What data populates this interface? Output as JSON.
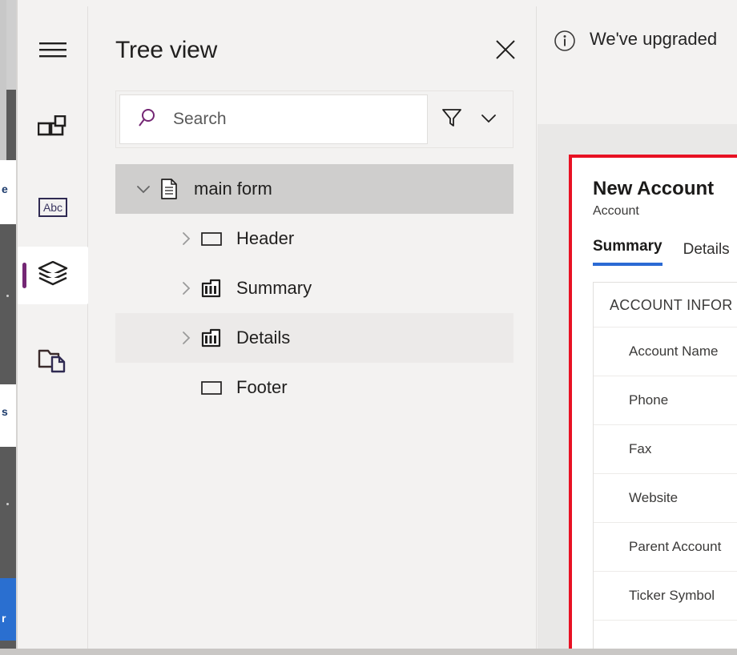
{
  "edge_panel": {
    "fragment_texts": [
      "e",
      "s"
    ],
    "button_fragment": "r"
  },
  "rail": {
    "items": [
      {
        "name": "hamburger-menu",
        "icon": "hamburger-icon",
        "active": false
      },
      {
        "name": "components",
        "icon": "components-grid-icon",
        "active": false
      },
      {
        "name": "text-label",
        "icon": "abc-text-icon",
        "active": false,
        "glyph": "Abc"
      },
      {
        "name": "tree-view",
        "icon": "layers-icon",
        "active": true
      },
      {
        "name": "related-files",
        "icon": "folder-file-icon",
        "active": false
      }
    ],
    "accent_color": "#742774"
  },
  "tree_panel": {
    "title": "Tree view",
    "close_label": "close-icon",
    "search": {
      "placeholder": "Search",
      "value": "",
      "icon": "search-icon",
      "filter_icon": "filter-funnel-icon",
      "chevron_icon": "chevron-down-icon"
    },
    "rows": [
      {
        "label": "main form",
        "icon": "document-icon",
        "twisty": "chevron-down-icon",
        "indent": 0,
        "state": "selected"
      },
      {
        "label": "Header",
        "icon": "rectangle-icon",
        "twisty": "chevron-right-icon",
        "indent": 1,
        "state": "normal"
      },
      {
        "label": "Summary",
        "icon": "columns-icon",
        "twisty": "chevron-right-icon",
        "indent": 1,
        "state": "normal"
      },
      {
        "label": "Details",
        "icon": "columns-icon",
        "twisty": "chevron-right-icon",
        "indent": 1,
        "state": "hover"
      },
      {
        "label": "Footer",
        "icon": "rectangle-icon",
        "twisty": "none",
        "indent": 1,
        "state": "normal"
      }
    ]
  },
  "main": {
    "banner": {
      "icon": "info-circle-icon",
      "text": "We've upgraded"
    },
    "form_preview": {
      "highlight_color": "#e81123",
      "title": "New Account",
      "subtitle": "Account",
      "tabs": [
        {
          "label": "Summary",
          "active": true
        },
        {
          "label": "Details",
          "active": false
        }
      ],
      "tab_accent_color": "#2b6ad4",
      "section": {
        "header": "ACCOUNT INFOR",
        "fields": [
          {
            "label": "Account Name"
          },
          {
            "label": "Phone"
          },
          {
            "label": "Fax"
          },
          {
            "label": "Website"
          },
          {
            "label": "Parent Account"
          },
          {
            "label": "Ticker Symbol"
          }
        ]
      }
    }
  }
}
